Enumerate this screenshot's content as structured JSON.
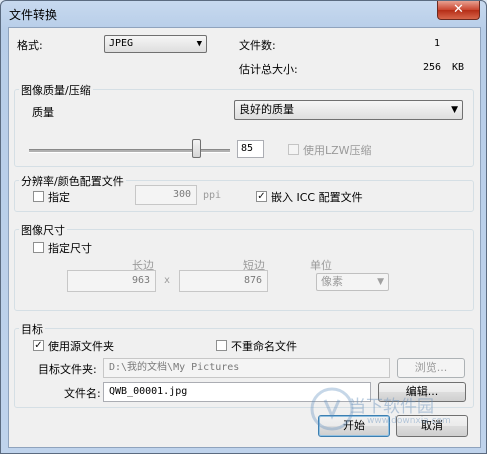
{
  "window": {
    "title": "文件转换",
    "close_glyph": "✕"
  },
  "top": {
    "format_label": "格式:",
    "format_value": "JPEG",
    "file_count_label": "文件数:",
    "file_count_value": "1",
    "est_size_label": "估计总大小:",
    "est_size_value": "256",
    "est_size_unit": "KB"
  },
  "quality_group": {
    "title": "图像质量/压缩",
    "quality_label": "质量",
    "quality_value": "良好的质量",
    "slider_value": "85",
    "slider_fraction": 0.85,
    "lzw_label": "使用LZW压缩"
  },
  "resolution_group": {
    "title": "分辨率/颜色配置文件",
    "specify_label": "指定",
    "dpi_value": "300",
    "dpi_unit": "ppi",
    "embed_icc_label": "嵌入 ICC 配置文件"
  },
  "size_group": {
    "title": "图像尺寸",
    "specify_size_label": "指定尺寸",
    "long_side_label": "长边",
    "short_side_label": "短边",
    "unit_label": "单位",
    "long_value": "963",
    "times": "x",
    "short_value": "876",
    "unit_value": "像素"
  },
  "target_group": {
    "title": "目标",
    "use_source_label": "使用源文件夹",
    "no_rename_label": "不重命名文件",
    "folder_label": "目标文件夹:",
    "folder_value": "D:\\我的文档\\My Pictures",
    "browse_label": "浏览...",
    "filename_label": "文件名:",
    "filename_value": "QWB_00001.jpg",
    "edit_label": "编辑..."
  },
  "buttons": {
    "start": "开始",
    "cancel": "取消"
  },
  "watermark": {
    "text": "当下软件园",
    "url": "www.downxia.com"
  }
}
